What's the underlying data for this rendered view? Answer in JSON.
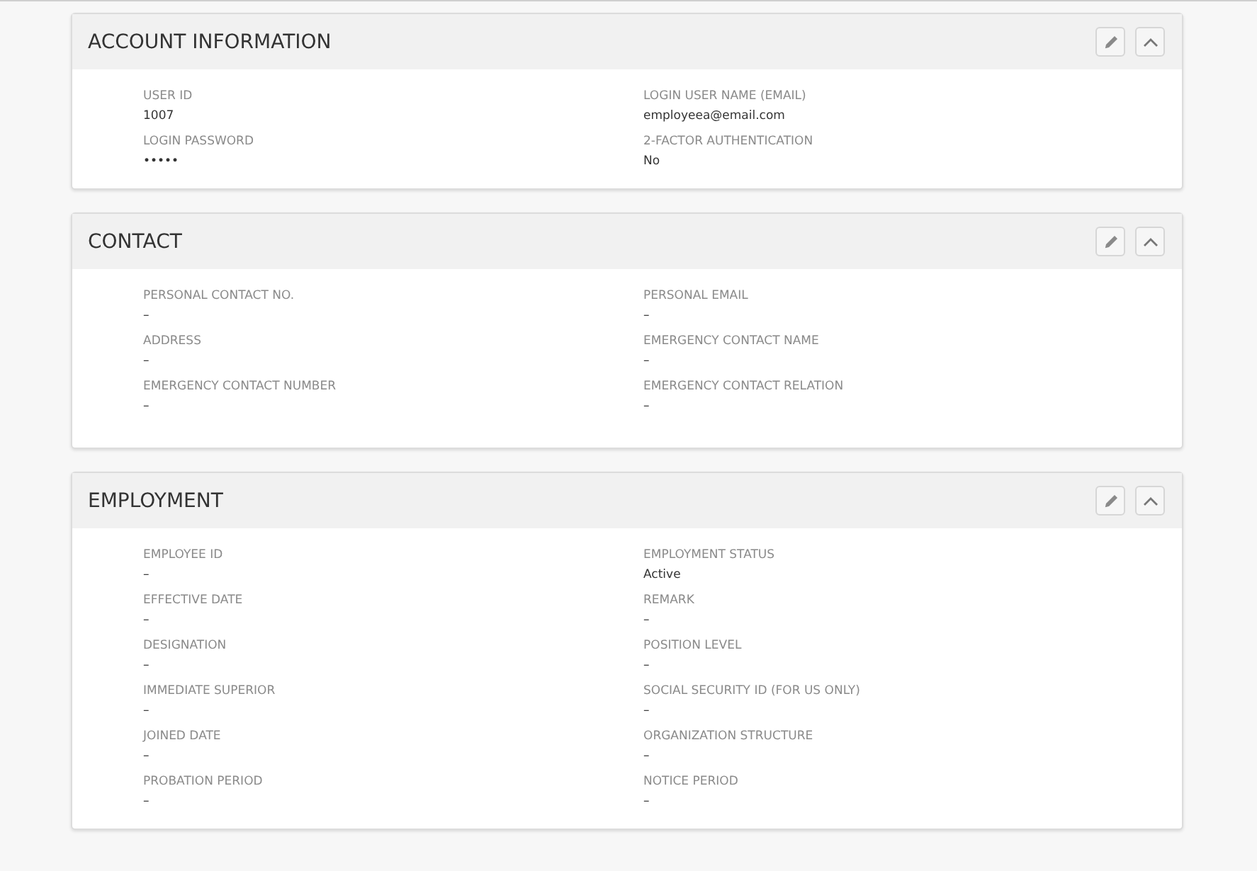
{
  "panels": [
    {
      "title": "ACCOUNT INFORMATION",
      "fields": [
        {
          "label": "USER ID",
          "value": "1007"
        },
        {
          "label": "LOGIN USER NAME (EMAIL)",
          "value": "employeea@email.com"
        },
        {
          "label": "LOGIN PASSWORD",
          "value": "•••••"
        },
        {
          "label": "2-FACTOR AUTHENTICATION",
          "value": "No"
        }
      ]
    },
    {
      "title": "CONTACT",
      "fields": [
        {
          "label": "PERSONAL CONTACT NO.",
          "value": "–"
        },
        {
          "label": "PERSONAL EMAIL",
          "value": "–"
        },
        {
          "label": "ADDRESS",
          "value": "–"
        },
        {
          "label": "EMERGENCY CONTACT NAME",
          "value": "–"
        },
        {
          "label": "EMERGENCY CONTACT NUMBER",
          "value": "–"
        },
        {
          "label": "EMERGENCY CONTACT RELATION",
          "value": "–"
        }
      ]
    },
    {
      "title": "EMPLOYMENT",
      "fields": [
        {
          "label": "EMPLOYEE ID",
          "value": "–"
        },
        {
          "label": "EMPLOYMENT STATUS",
          "value": "Active"
        },
        {
          "label": "EFFECTIVE DATE",
          "value": "–"
        },
        {
          "label": "REMARK",
          "value": "–"
        },
        {
          "label": "DESIGNATION",
          "value": "–"
        },
        {
          "label": "POSITION LEVEL",
          "value": "–"
        },
        {
          "label": "IMMEDIATE SUPERIOR",
          "value": "–"
        },
        {
          "label": "SOCIAL SECURITY ID (FOR US ONLY)",
          "value": "–"
        },
        {
          "label": "JOINED DATE",
          "value": "–"
        },
        {
          "label": "ORGANIZATION STRUCTURE",
          "value": "–"
        },
        {
          "label": "PROBATION PERIOD",
          "value": "–"
        },
        {
          "label": "NOTICE PERIOD",
          "value": "–"
        }
      ]
    }
  ]
}
